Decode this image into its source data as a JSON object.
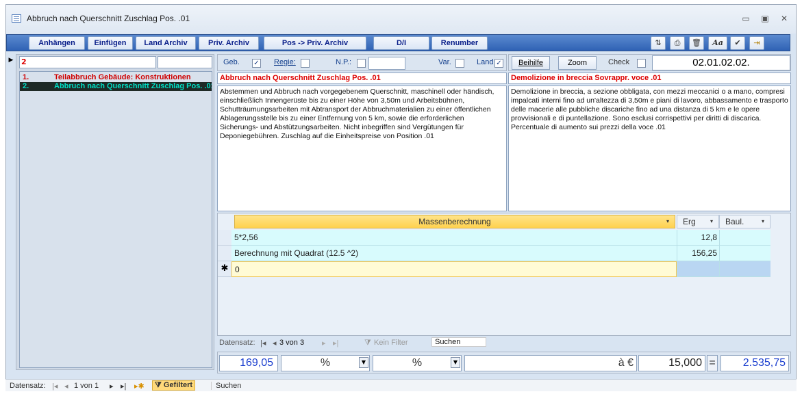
{
  "window": {
    "title": "Abbruch nach Querschnitt Zuschlag Pos. .01",
    "minimize": "▭",
    "maximize": "▣",
    "close": "✕"
  },
  "toolbar": {
    "buttons": [
      {
        "label": "Anhängen"
      },
      {
        "label": "Einfügen"
      },
      {
        "label": "Land Archiv"
      },
      {
        "label": "Priv. Archiv"
      },
      {
        "label": "Pos -> Priv. Archiv"
      },
      {
        "label": "D/I"
      },
      {
        "label": "Renumber"
      }
    ],
    "icons": [
      {
        "name": "sort-icon",
        "glyph": "⇅"
      },
      {
        "name": "print-icon",
        "glyph": "⎙"
      },
      {
        "name": "delete-icon",
        "glyph": "🗑"
      },
      {
        "name": "font-icon",
        "glyph": "Aa"
      },
      {
        "name": "check-icon",
        "glyph": "✔"
      },
      {
        "name": "exit-icon",
        "glyph": "⇥"
      }
    ]
  },
  "left_panel": {
    "header_value": "2",
    "items": [
      {
        "num": "1.",
        "label": "Teilabbruch Gebäude: Konstruktionen",
        "color": "#d00000"
      },
      {
        "num": "2.",
        "label": "Abbruch nach Querschnitt Zuschlag Pos. .01",
        "color": "#00d8c0",
        "selected": true
      }
    ]
  },
  "header": {
    "geb_label": "Geb.",
    "geb_checked": "✓",
    "regie_label": "Regie:",
    "np_label": "N.P.:",
    "var_label": "Var.",
    "land_label": "Land",
    "land_checked": "✓",
    "beihilfe": "Beihilfe",
    "zoom": "Zoom",
    "check_label": "Check",
    "code": "02.01.02.02."
  },
  "german": {
    "title": "Abbruch nach Querschnitt Zuschlag Pos. .01",
    "desc": "Abstemmen und Abbruch nach vorgegebenem Querschnitt, maschinell oder händisch, einschließlich Innengerüste bis zu einer Höhe von 3,50m und Arbeitsbühnen, Schutträumungsarbeiten mit Abtransport der Abbruchmaterialien zu einer öffentlichen Ablagerungsstelle bis zu einer Entfernung von 5 km, sowie die erforderlichen Sicherungs- und Abstützungsarbeiten. Nicht inbegriffen sind Vergütungen für Deponiegebühren. Zuschlag auf die Einheitspreise von Position .01"
  },
  "italian": {
    "title": "Demolizione in breccia Sovrappr. voce .01",
    "desc": "Demolizione in breccia, a sezione obbligata, con mezzi meccanici o a mano, compresi impalcati interni fino ad un'altezza di 3,50m e piani di lavoro, abbassamento e trasporto delle macerie alle pubbliche discariche fino ad una distanza di 5 km e le opere provvisionali e di puntellazione. Sono esclusi corrispettivi per diritti di discarica. Percentuale di aumento sui prezzi della voce .01"
  },
  "grid": {
    "col_main": "Massenberechnung",
    "col_erg": "Erg",
    "col_baul": "Baul.",
    "rows": [
      {
        "formula": "5*2,56",
        "erg": "12,8"
      },
      {
        "formula": "Berechnung mit Quadrat (12.5 ^2)",
        "erg": "156,25"
      }
    ],
    "new_row_marker": "✱",
    "new_row_value": "0"
  },
  "inner_nav": {
    "label": "Datensatz:",
    "position": "3 von 3",
    "filter": "Kein Filter",
    "search": "Suchen"
  },
  "totals": {
    "sum": "169,05",
    "pct1": "%",
    "pct2": "%",
    "price_label": "à €",
    "price": "15,000",
    "equals": "=",
    "total": "2.535,75"
  },
  "status": {
    "label": "Datensatz:",
    "position": "1 von 1",
    "filter": "Gefiltert",
    "search": "Suchen"
  }
}
